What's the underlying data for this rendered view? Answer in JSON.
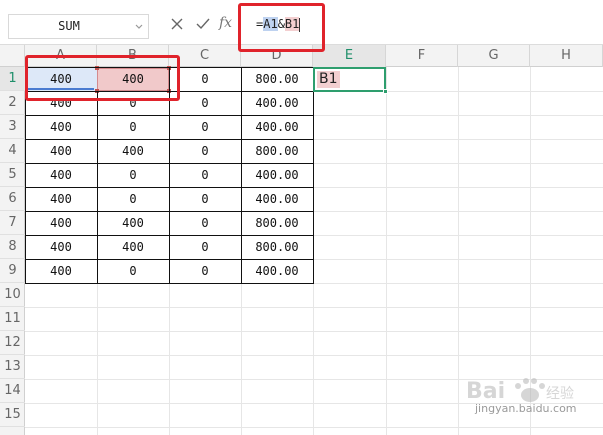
{
  "formula_bar": {
    "name_box": "SUM",
    "fx_label": "fx",
    "formula_prefix": "=",
    "formula_ref1": "A1",
    "formula_amp": "&",
    "formula_ref2": "B1",
    "cancel_icon": "cancel-x-icon",
    "confirm_icon": "confirm-check-icon"
  },
  "columns": [
    "A",
    "B",
    "C",
    "D",
    "E",
    "F",
    "G",
    "H"
  ],
  "rows": [
    "1",
    "2",
    "3",
    "4",
    "5",
    "6",
    "7",
    "8",
    "9",
    "10",
    "11",
    "12",
    "13",
    "14",
    "15"
  ],
  "cells": [
    [
      "400",
      "400",
      "0",
      "800.00"
    ],
    [
      "400",
      "0",
      "0",
      "400.00"
    ],
    [
      "400",
      "0",
      "0",
      "400.00"
    ],
    [
      "400",
      "400",
      "0",
      "800.00"
    ],
    [
      "400",
      "0",
      "0",
      "400.00"
    ],
    [
      "400",
      "0",
      "0",
      "400.00"
    ],
    [
      "400",
      "400",
      "0",
      "800.00"
    ],
    [
      "400",
      "400",
      "0",
      "800.00"
    ],
    [
      "400",
      "0",
      "0",
      "400.00"
    ]
  ],
  "active_cell": {
    "column": "E",
    "row": "1",
    "display": "B1"
  },
  "colors": {
    "accent": "#2e9e6e",
    "ref1_highlight": "#bed2f0",
    "ref2_highlight": "#f3cfd0",
    "annotation_red": "#e0232b"
  },
  "watermark": {
    "text": "jingyan.baidu.com"
  }
}
